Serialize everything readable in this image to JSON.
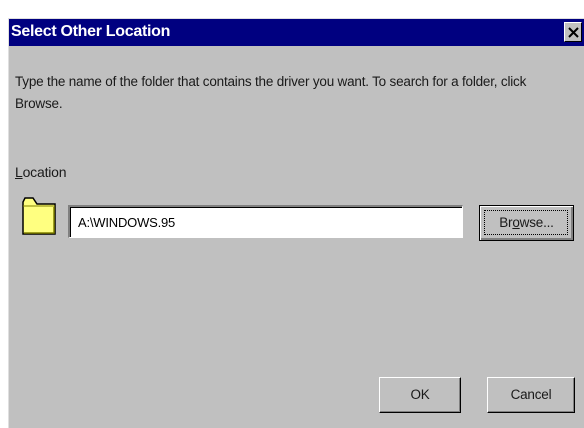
{
  "dialog": {
    "title": "Select Other Location",
    "instructions": "Type the name of the folder that contains the driver you want. To search for a folder, click Browse.",
    "location_label_accel": "L",
    "location_label_rest": "ocation",
    "location_value": "A:\\WINDOWS.95",
    "browse_label_pre": "Br",
    "browse_label_accel": "o",
    "browse_label_post": "wse...",
    "ok_label": "OK",
    "cancel_label": "Cancel",
    "folder_icon": "folder-icon",
    "close_icon": "close-icon",
    "colors": {
      "title_bar": "#000080",
      "face": "#c0c0c0",
      "folder": "#ffff80"
    }
  }
}
